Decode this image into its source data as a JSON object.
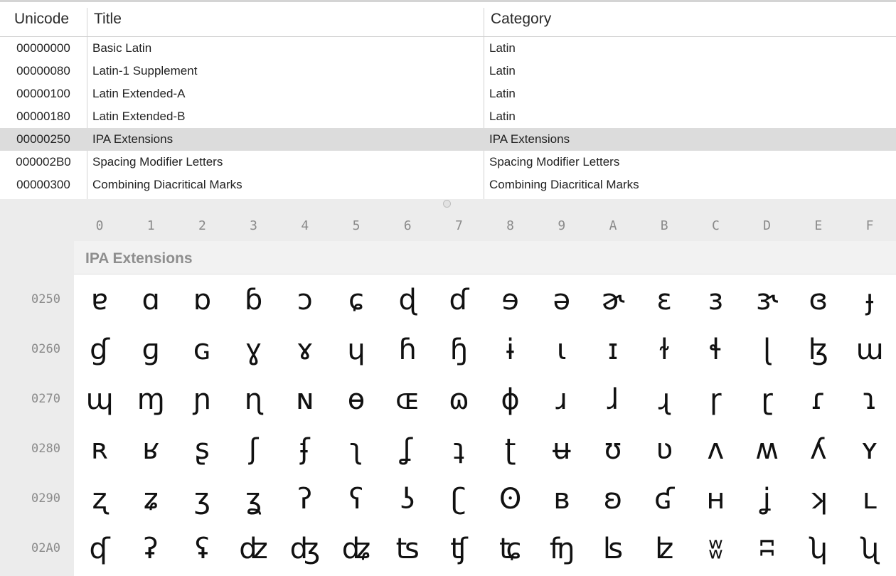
{
  "blocks_table": {
    "headers": {
      "unicode": "Unicode",
      "title": "Title",
      "category": "Category"
    },
    "rows": [
      {
        "code": "00000000",
        "title": "Basic Latin",
        "category": "Latin"
      },
      {
        "code": "00000080",
        "title": "Latin-1 Supplement",
        "category": "Latin"
      },
      {
        "code": "00000100",
        "title": "Latin Extended-A",
        "category": "Latin"
      },
      {
        "code": "00000180",
        "title": "Latin Extended-B",
        "category": "Latin"
      },
      {
        "code": "00000250",
        "title": "IPA Extensions",
        "category": "IPA Extensions",
        "selected": true
      },
      {
        "code": "000002B0",
        "title": "Spacing Modifier Letters",
        "category": "Spacing Modifier Letters"
      },
      {
        "code": "00000300",
        "title": "Combining Diacritical Marks",
        "category": "Combining Diacritical Marks"
      }
    ]
  },
  "character_grid": {
    "column_headers": [
      "0",
      "1",
      "2",
      "3",
      "4",
      "5",
      "6",
      "7",
      "8",
      "9",
      "A",
      "B",
      "C",
      "D",
      "E",
      "F"
    ],
    "section_title": "IPA Extensions",
    "rows": [
      {
        "label": "0250",
        "glyphs": [
          "ɐ",
          "ɑ",
          "ɒ",
          "ɓ",
          "ɔ",
          "ɕ",
          "ɖ",
          "ɗ",
          "ɘ",
          "ə",
          "ɚ",
          "ɛ",
          "ɜ",
          "ɝ",
          "ɞ",
          "ɟ"
        ]
      },
      {
        "label": "0260",
        "glyphs": [
          "ɠ",
          "ɡ",
          "ɢ",
          "ɣ",
          "ɤ",
          "ɥ",
          "ɦ",
          "ɧ",
          "ɨ",
          "ɩ",
          "ɪ",
          "ɫ",
          "ɬ",
          "ɭ",
          "ɮ",
          "ɯ"
        ]
      },
      {
        "label": "0270",
        "glyphs": [
          "ɰ",
          "ɱ",
          "ɲ",
          "ɳ",
          "ɴ",
          "ɵ",
          "ɶ",
          "ɷ",
          "ɸ",
          "ɹ",
          "ɺ",
          "ɻ",
          "ɼ",
          "ɽ",
          "ɾ",
          "ɿ"
        ]
      },
      {
        "label": "0280",
        "glyphs": [
          "ʀ",
          "ʁ",
          "ʂ",
          "ʃ",
          "ʄ",
          "ʅ",
          "ʆ",
          "ʇ",
          "ʈ",
          "ʉ",
          "ʊ",
          "ʋ",
          "ʌ",
          "ʍ",
          "ʎ",
          "ʏ"
        ]
      },
      {
        "label": "0290",
        "glyphs": [
          "ʐ",
          "ʑ",
          "ʒ",
          "ʓ",
          "ʔ",
          "ʕ",
          "ʖ",
          "ʗ",
          "ʘ",
          "ʙ",
          "ʚ",
          "ʛ",
          "ʜ",
          "ʝ",
          "ʞ",
          "ʟ"
        ]
      },
      {
        "label": "02A0",
        "glyphs": [
          "ʠ",
          "ʡ",
          "ʢ",
          "ʣ",
          "ʤ",
          "ʥ",
          "ʦ",
          "ʧ",
          "ʨ",
          "ʩ",
          "ʪ",
          "ʫ",
          "ʬ",
          "ʭ",
          "ʮ",
          "ʯ"
        ]
      }
    ]
  }
}
